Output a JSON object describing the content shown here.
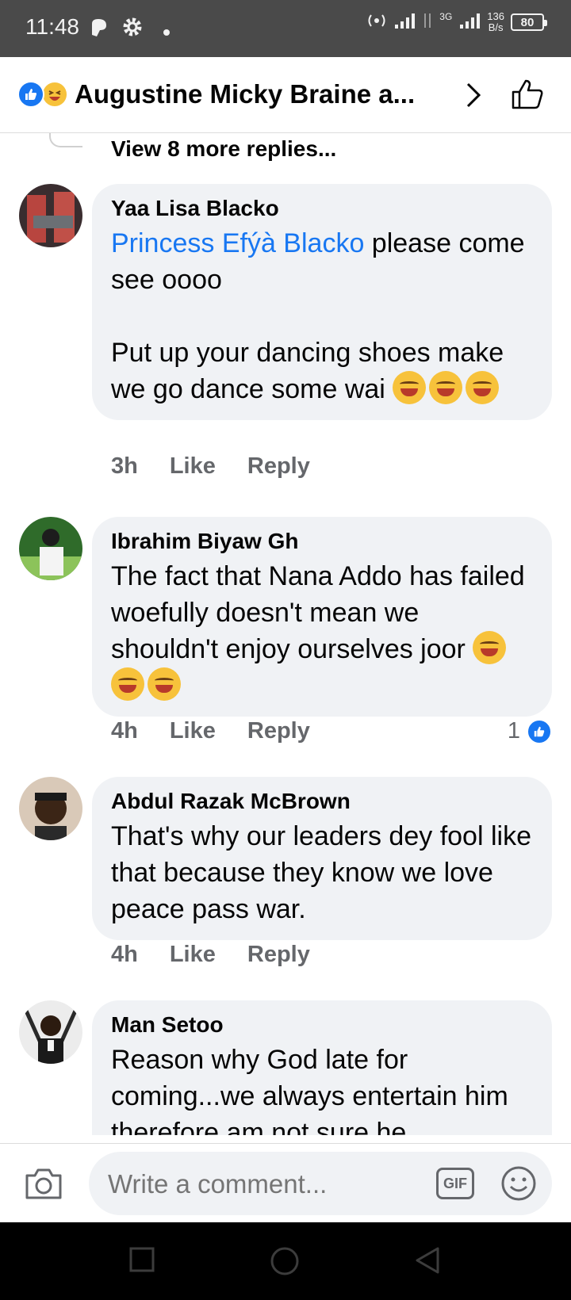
{
  "status_bar": {
    "time": "11:48",
    "network": "3G",
    "speed_value": "136",
    "speed_unit": "B/s",
    "battery": "80"
  },
  "header": {
    "title": "Augustine Micky Braine a..."
  },
  "thread": {
    "view_more": "View 8 more replies..."
  },
  "comments": [
    {
      "author": "Yaa Lisa Blacko",
      "mention": "Princess Efýà Blacko",
      "line1_rest": " please come see oooo",
      "line2": "Put up your dancing shoes make we go dance some wai ",
      "time": "3h",
      "like": "Like",
      "reply": "Reply"
    },
    {
      "author": "Ibrahim Biyaw Gh",
      "text": "The fact that Nana Addo has failed woefully doesn't mean we shouldn't enjoy ourselves joor ",
      "time": "4h",
      "like": "Like",
      "reply": "Reply",
      "reactions": "1"
    },
    {
      "author": "Abdul Razak McBrown",
      "text": "That's why our leaders dey fool like that because they know we love peace pass war.",
      "time": "4h",
      "like": "Like",
      "reply": "Reply"
    },
    {
      "author": "Man Setoo",
      "text": "Reason why God late for coming...we always entertain him therefore am not sure he"
    }
  ],
  "composer": {
    "placeholder": "Write a comment...",
    "gif_label": "GIF"
  },
  "colors": {
    "accent": "#1877f2",
    "bubble": "#f0f2f5",
    "secondary_text": "#65676b"
  }
}
